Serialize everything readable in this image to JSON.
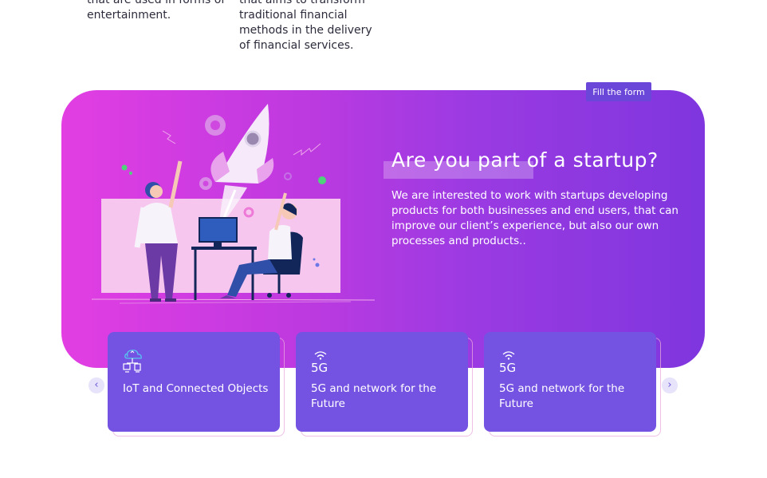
{
  "top_texts": [
    "that are used in forms of entertainment.",
    "that aims to transform traditional financial methods in the delivery of financial services."
  ],
  "cta": {
    "fill_form_label": "Fill the form"
  },
  "banner": {
    "title": "Are you part of a startup?",
    "description": "We are interested to work with startups developing products for both businesses and end users, that can improve our client’s experience, but also our own processes and products..",
    "colors": {
      "gradient_start": "#e23ee2",
      "gradient_end": "#7f36de"
    }
  },
  "cards": [
    {
      "icon": "iot-devices-icon",
      "label": "IoT and Connected Objects"
    },
    {
      "icon": "5g-network-icon",
      "icon_text": "5G",
      "label": "5G and network for the Future"
    },
    {
      "icon": "5g-network-icon",
      "icon_text": "5G",
      "label": "5G and network for the Future"
    }
  ],
  "carousel": {
    "prev_glyph": "‹",
    "next_glyph": "›"
  },
  "colors": {
    "card_bg": "#7553e2",
    "button_bg": "#6a46d9",
    "arrow_bg": "#e6e3fb"
  }
}
